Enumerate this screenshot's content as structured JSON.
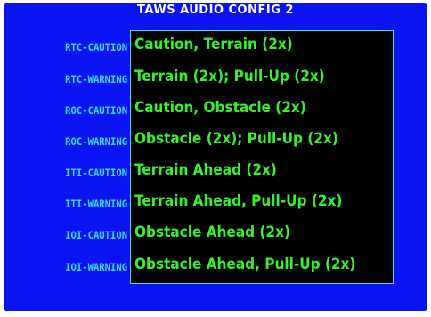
{
  "title": "TAWS AUDIO CONFIG 2",
  "colors": {
    "background": "#0a14f2",
    "label": "#36dcf2",
    "value": "#35f22a",
    "box_background": "#000000",
    "title": "#ffffff"
  },
  "rows": [
    {
      "label": "RTC-CAUTION",
      "value": "Caution, Terrain (2x)"
    },
    {
      "label": "RTC-WARNING",
      "value": "Terrain (2x); Pull-Up (2x)"
    },
    {
      "label": "ROC-CAUTION",
      "value": "Caution, Obstacle (2x)"
    },
    {
      "label": "ROC-WARNING",
      "value": "Obstacle (2x); Pull-Up (2x)"
    },
    {
      "label": "ITI-CAUTION",
      "value": "Terrain Ahead (2x)"
    },
    {
      "label": "ITI-WARNING",
      "value": "Terrain Ahead, Pull-Up (2x)"
    },
    {
      "label": "IOI-CAUTION",
      "value": "Obstacle Ahead (2x)"
    },
    {
      "label": "IOI-WARNING",
      "value": "Obstacle Ahead, Pull-Up (2x)"
    }
  ]
}
